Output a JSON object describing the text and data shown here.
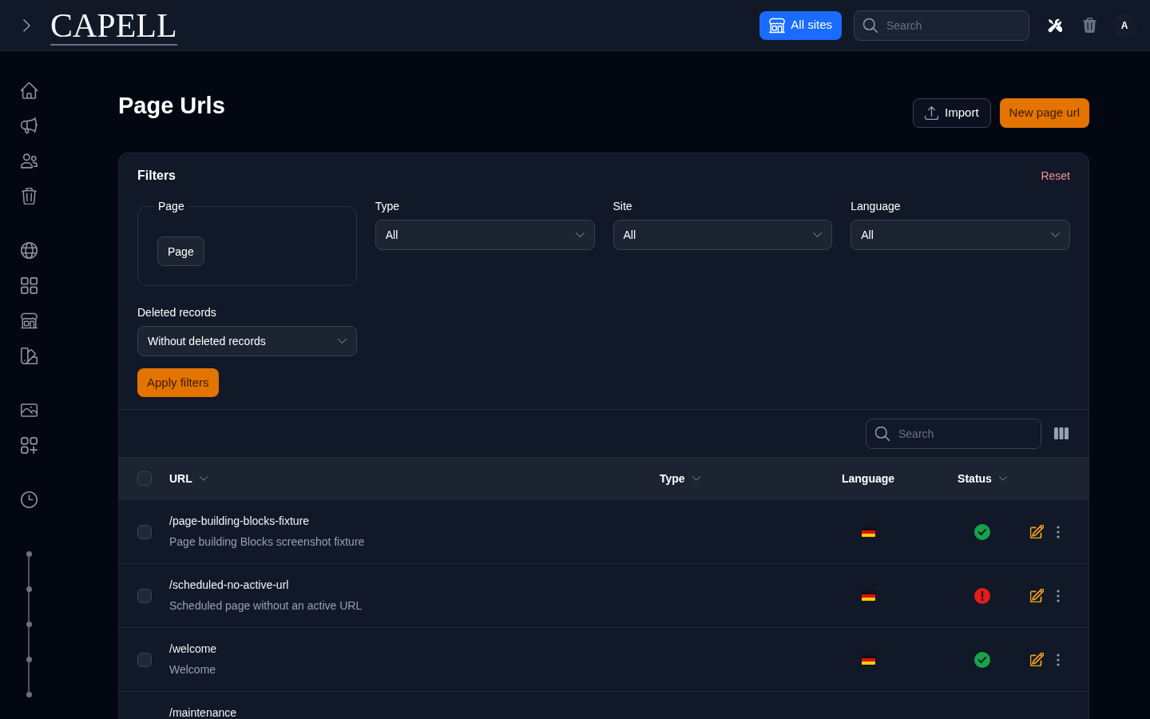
{
  "topbar": {
    "logo": "CAPELL",
    "site_button": "All sites",
    "search": {
      "placeholder": "Search"
    },
    "avatar": "A"
  },
  "page": {
    "title": "Page Urls",
    "actions": [
      {
        "label": "Import",
        "kind": "import"
      },
      {
        "label": "New page url",
        "kind": "create"
      }
    ]
  },
  "filters": {
    "title": "Filters",
    "reset": "Reset",
    "page_group": {
      "legend": "Page",
      "button": "Page"
    },
    "selects": [
      {
        "label": "Type",
        "value": "All"
      },
      {
        "label": "Site",
        "value": "All"
      },
      {
        "label": "Language",
        "value": "All"
      }
    ],
    "deleted_records": {
      "label": "Deleted records",
      "value": "Without deleted records"
    },
    "apply": "Apply filters"
  },
  "table": {
    "search": {
      "placeholder": "Search"
    },
    "select_all": {
      "checked": false
    },
    "columns": [
      {
        "label": "URL",
        "sortable": true
      },
      {
        "label": "Type",
        "sortable": true
      },
      {
        "label": "Language",
        "sortable": false
      },
      {
        "label": "Status",
        "sortable": true
      }
    ],
    "rows": [
      {
        "checked": false,
        "url": "/page-building-blocks-fixture",
        "description": "Page building Blocks screenshot fixture",
        "active": true
      },
      {
        "checked": false,
        "url": "/scheduled-no-active-url",
        "description": "Scheduled page without an active URL",
        "active": false
      },
      {
        "checked": false,
        "url": "/welcome",
        "description": "Welcome",
        "active": true
      },
      {
        "url": "/maintenance"
      }
    ]
  }
}
